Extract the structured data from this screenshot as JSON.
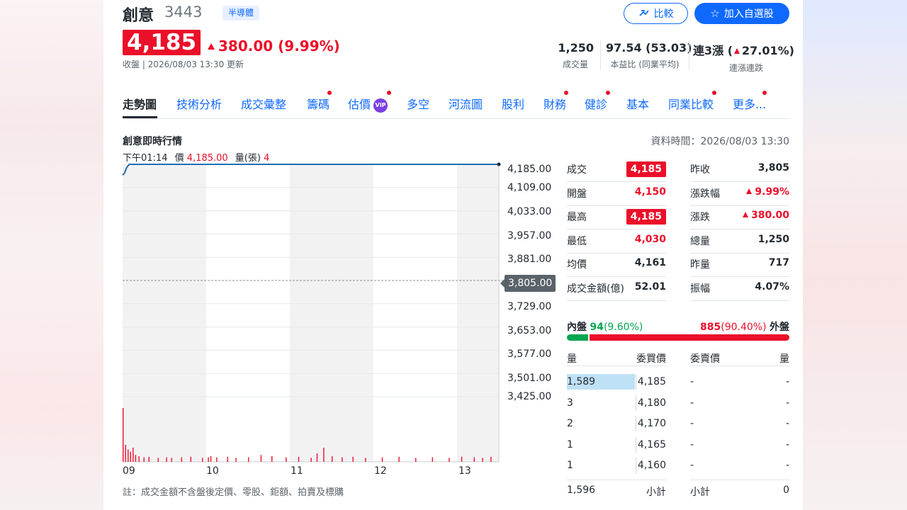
{
  "header": {
    "name": "創意",
    "ticker": "3443",
    "industry_tag": "半導體",
    "compare_label": "比較",
    "watchlist_label": "加入自選股"
  },
  "quote": {
    "price": "4,185",
    "change": "380.00 (9.99%)",
    "close_note": "收盤 | 2026/08/03 13:30 更新"
  },
  "stats": [
    {
      "value": "1,250",
      "label": "成交量"
    },
    {
      "value": "97.54 (53.03)",
      "label": "本益比 (同業平均)"
    },
    {
      "value_prefix": "連3漲 (",
      "value_change": "27.01%)",
      "label": "連漲連跌"
    }
  ],
  "tabs": [
    "走勢圖",
    "技術分析",
    "成交彙整",
    "籌碼",
    "估價",
    "多空",
    "河流圖",
    "股利",
    "財務",
    "健診",
    "基本",
    "同業比較",
    "更多..."
  ],
  "vip_label": "VIP",
  "section": {
    "title": "創意即時行情",
    "data_time": "資料時間：2026/08/03 13:30",
    "tooltip_time": "下午01:14",
    "tooltip_price_label": "價",
    "tooltip_price": "4,185.00",
    "tooltip_vol_label": "量(張)",
    "tooltip_vol": "4",
    "footnote": "註：成交金額不含盤後定價、零股、鉅額、拍賣及標購"
  },
  "chart_data": {
    "type": "line",
    "y_ticks": [
      "4,185.00",
      "4,109.00",
      "4,033.00",
      "3,957.00",
      "3,881.00",
      "3,805.00",
      "3,729.00",
      "3,653.00",
      "3,577.00",
      "3,501.00",
      "3,425.00"
    ],
    "prev_close": "3,805.00",
    "ylim": [
      3425,
      4185
    ],
    "x_ticks": [
      "09",
      "10",
      "11",
      "12",
      "13"
    ],
    "price_series": {
      "time_hours": [
        9.0,
        9.02,
        9.05,
        9.08,
        9.1,
        13.5
      ],
      "price": [
        4150,
        4155,
        4175,
        4185,
        4185,
        4185
      ]
    },
    "volume_bars": {
      "time_hours": [
        9.0,
        9.03,
        9.06,
        9.09,
        9.12,
        9.15,
        9.19,
        9.25,
        9.31,
        9.42,
        9.52,
        9.58,
        9.7,
        9.81,
        9.95,
        10.02,
        10.05,
        10.12,
        10.25,
        10.35,
        10.5,
        10.65,
        10.78,
        10.95,
        11.1,
        11.25,
        11.32,
        11.4,
        11.5,
        11.62,
        11.75,
        11.9,
        12.1,
        12.3,
        12.5,
        12.7,
        12.9,
        13.05,
        13.2,
        13.3,
        13.4
      ],
      "volume": [
        95,
        30,
        22,
        18,
        25,
        12,
        10,
        8,
        9,
        7,
        8,
        7,
        8,
        9,
        7,
        8,
        10,
        8,
        9,
        7,
        8,
        12,
        10,
        8,
        9,
        7,
        15,
        25,
        10,
        8,
        9,
        7,
        8,
        9,
        7,
        8,
        7,
        9,
        8,
        7,
        9
      ]
    }
  },
  "quote_table": {
    "left": [
      {
        "label": "成交",
        "value": "4,185",
        "boxed": true
      },
      {
        "label": "開盤",
        "value": "4,150",
        "color": "red"
      },
      {
        "label": "最高",
        "value": "4,185",
        "boxed": true
      },
      {
        "label": "最低",
        "value": "4,030",
        "color": "red"
      },
      {
        "label": "均價",
        "value": "4,161"
      },
      {
        "label": "成交金額(億)",
        "value": "52.01"
      }
    ],
    "right": [
      {
        "label": "昨收",
        "value": "3,805"
      },
      {
        "label": "漲跌幅",
        "value": "9.99%",
        "color": "red",
        "arrow": true
      },
      {
        "label": "漲跌",
        "value": "380.00",
        "color": "red",
        "arrow": true
      },
      {
        "label": "總量",
        "value": "1,250"
      },
      {
        "label": "昨量",
        "value": "717"
      },
      {
        "label": "振幅",
        "value": "4.07%"
      }
    ]
  },
  "inner_outer": {
    "inner_label": "內盤",
    "inner_value": "94",
    "inner_pct": "(9.60%)",
    "outer_value": "885",
    "outer_pct": "(90.40%)",
    "outer_label": "外盤",
    "inner_fraction": 0.096
  },
  "order_book": {
    "headers": [
      "量",
      "委買價",
      "委賣價",
      "量"
    ],
    "rows": [
      {
        "bid_vol": "1,589",
        "bid_price": "4,185",
        "ask_price": "-",
        "ask_vol": "-",
        "bid_fraction": 1.0
      },
      {
        "bid_vol": "3",
        "bid_price": "4,180",
        "ask_price": "-",
        "ask_vol": "-",
        "bid_fraction": 0.0
      },
      {
        "bid_vol": "2",
        "bid_price": "4,170",
        "ask_price": "-",
        "ask_vol": "-",
        "bid_fraction": 0.0
      },
      {
        "bid_vol": "1",
        "bid_price": "4,165",
        "ask_price": "-",
        "ask_vol": "-",
        "bid_fraction": 0.0
      },
      {
        "bid_vol": "1",
        "bid_price": "4,160",
        "ask_price": "-",
        "ask_vol": "-",
        "bid_fraction": 0.0
      }
    ],
    "total_bid": "1,596",
    "subtotal_label": "小計",
    "total_ask": "0"
  },
  "colors": {
    "up": "#eb0f29",
    "down": "#00a651",
    "accent": "#0f69ff",
    "line": "#1f6fb2"
  }
}
